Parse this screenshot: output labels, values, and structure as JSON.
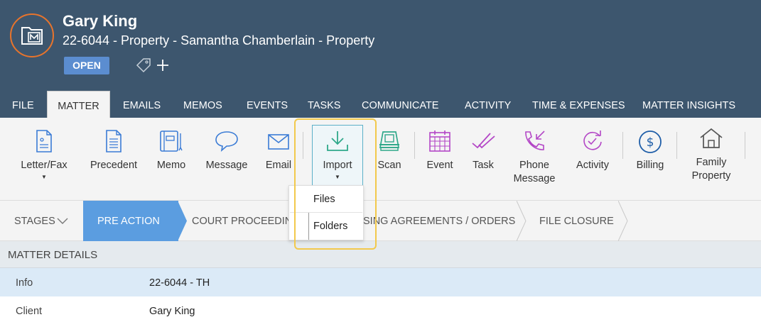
{
  "header": {
    "client_name": "Gary King",
    "matter_description": "22-6044 - Property - Samantha Chamberlain - Property",
    "status": "OPEN",
    "avatar_color": "#e8742c",
    "background_color": "#3d566e"
  },
  "tabs": [
    {
      "label": "FILE"
    },
    {
      "label": "MATTER",
      "active": true
    },
    {
      "label": "EMAILS"
    },
    {
      "label": "MEMOS"
    },
    {
      "label": "EVENTS"
    },
    {
      "label": "TASKS"
    },
    {
      "label": "COMMUNICATE"
    },
    {
      "label": "ACTIVITY"
    },
    {
      "label": "TIME & EXPENSES"
    },
    {
      "label": "MATTER INSIGHTS"
    }
  ],
  "ribbon": {
    "letter_fax": "Letter/Fax",
    "precedent": "Precedent",
    "memo": "Memo",
    "message": "Message",
    "email": "Email",
    "import": "Import",
    "scan": "Scan",
    "event": "Event",
    "task": "Task",
    "phone_message_1": "Phone",
    "phone_message_2": "Message",
    "activity": "Activity",
    "billing": "Billing",
    "family_property_1": "Family",
    "family_property_2": "Property"
  },
  "import_menu": {
    "files": "Files",
    "folders": "Folders"
  },
  "stages": {
    "label": "STAGES",
    "active": "PRE ACTION",
    "court_proceedings": "COURT PROCEEDING",
    "agreements": "SING AGREEMENTS / ORDERS",
    "file_closure": "FILE CLOSURE"
  },
  "details": {
    "title": "MATTER DETAILS",
    "rows": [
      {
        "label": "Info",
        "value": "22-6044 - TH"
      },
      {
        "label": "Client",
        "value": "Gary King"
      }
    ]
  }
}
